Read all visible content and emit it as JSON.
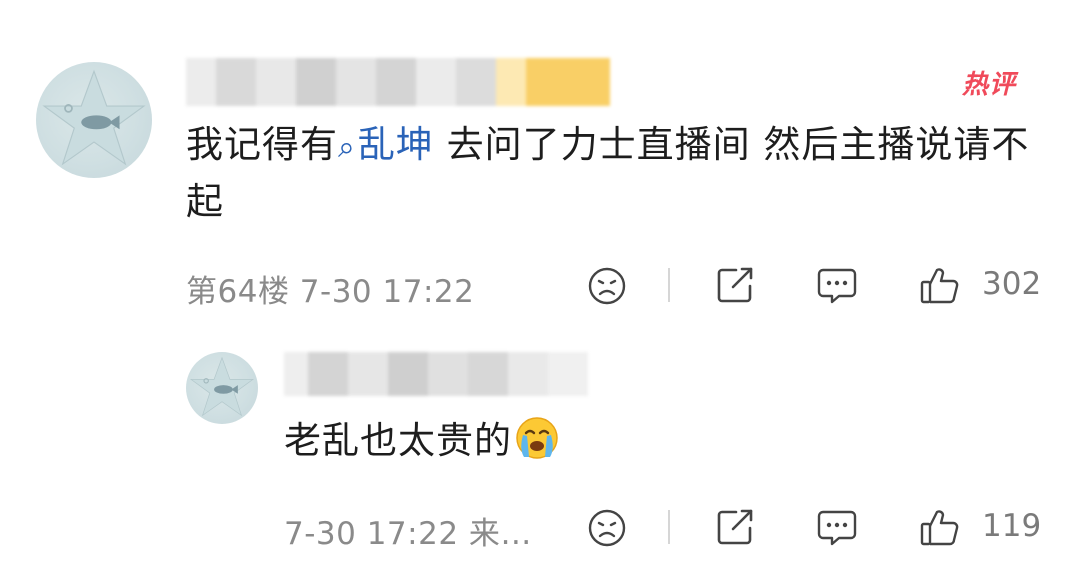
{
  "comment": {
    "badge": "热评",
    "text_before": "我记得有",
    "topic_icon": "search-icon",
    "topic": "乱坤",
    "text_after": " 去问了力士直播间 然后主播说请不起",
    "meta": "第64楼 7-30 17:22",
    "like_count": "302"
  },
  "reply": {
    "text": "老乱也太贵的",
    "emoji_icon": "crying-face-emoji",
    "meta": "7-30 17:22 来…",
    "like_count": "119"
  },
  "colors": {
    "link": "#2a63b8",
    "badge": "#f04a5a",
    "meta": "#8a8a8a"
  }
}
